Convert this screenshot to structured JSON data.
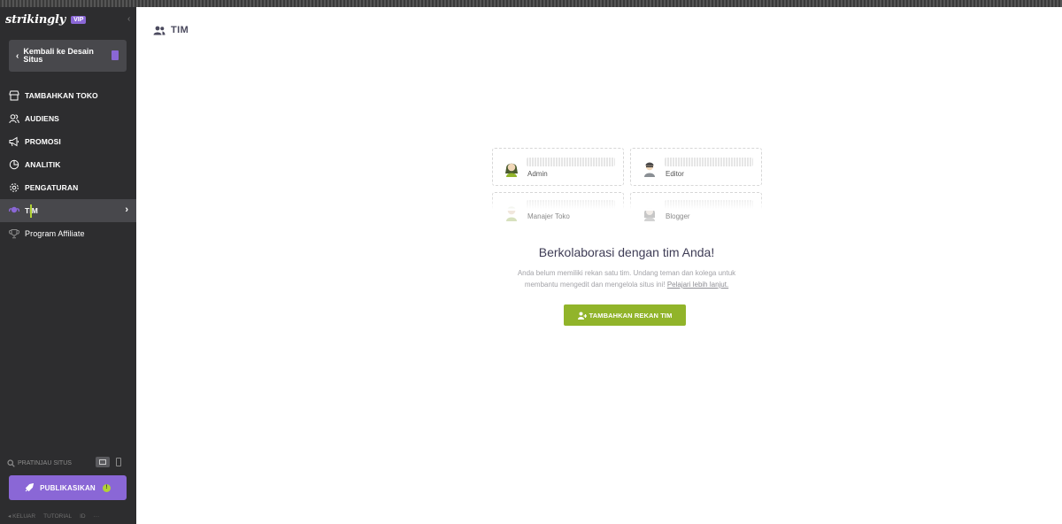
{
  "sidebar": {
    "logo": "strikingly",
    "badge": "VIP",
    "back_label": "Kembali ke Desain Situs",
    "nav": [
      {
        "label": "TAMBAHKAN TOKO",
        "icon": "store-icon"
      },
      {
        "label": "AUDIENS",
        "icon": "users-icon"
      },
      {
        "label": "PROMOSI",
        "icon": "megaphone-icon"
      },
      {
        "label": "ANALITIK",
        "icon": "pie-chart-icon"
      },
      {
        "label": "PENGATURAN",
        "icon": "gear-icon"
      },
      {
        "label": "TIM",
        "icon": "team-icon",
        "active": true
      },
      {
        "label": "Program Affiliate",
        "icon": "trophy-icon"
      }
    ],
    "preview_label": "PRATINJAU SITUS",
    "publish_label": "PUBLIKASIKAN",
    "publish_badge": "!",
    "footer": {
      "logout": "KELUAR",
      "tutorial": "TUTORIAL",
      "lang": "ID",
      "more": "···"
    }
  },
  "main": {
    "title": "TIM",
    "roles": [
      "Admin",
      "Editor",
      "Manajer Toko",
      "Blogger"
    ],
    "headline": "Berkolaborasi dengan tim Anda!",
    "desc_line1": "Anda belum memiliki rekan satu tim. Undang teman dan kolega untuk",
    "desc_line2": "membantu mengedit dan mengelola situs ini!",
    "learn_more": "Pelajari lebih lanjut.",
    "add_button": "TAMBAHKAN REKAN TIM"
  },
  "colors": {
    "sidebar_bg": "#2d2d2f",
    "accent_purple": "#8a67d6",
    "accent_green": "#91b42a",
    "active_marker": "#b2d235"
  }
}
